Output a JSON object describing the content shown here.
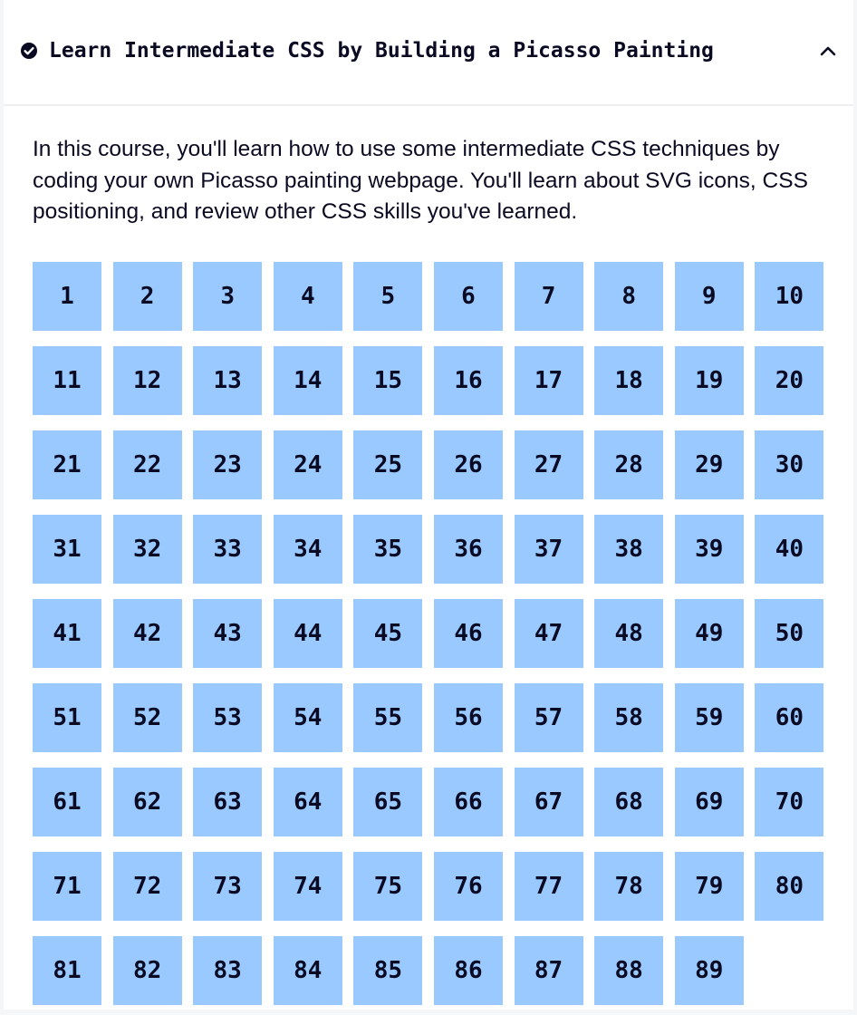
{
  "block": {
    "title": "Learn Intermediate CSS by Building a Picasso Painting",
    "status_icon": "check-circle-icon",
    "toggle_icon": "chevron-up-icon",
    "completed": true,
    "expanded": true
  },
  "intro_text": "In this course, you'll learn how to use some intermediate CSS techniques by coding your own Picasso painting webpage. You'll learn about SVG icons, CSS positioning, and review other CSS skills you've learned.",
  "steps": [
    "1",
    "2",
    "3",
    "4",
    "5",
    "6",
    "7",
    "8",
    "9",
    "10",
    "11",
    "12",
    "13",
    "14",
    "15",
    "16",
    "17",
    "18",
    "19",
    "20",
    "21",
    "22",
    "23",
    "24",
    "25",
    "26",
    "27",
    "28",
    "29",
    "30",
    "31",
    "32",
    "33",
    "34",
    "35",
    "36",
    "37",
    "38",
    "39",
    "40",
    "41",
    "42",
    "43",
    "44",
    "45",
    "46",
    "47",
    "48",
    "49",
    "50",
    "51",
    "52",
    "53",
    "54",
    "55",
    "56",
    "57",
    "58",
    "59",
    "60",
    "61",
    "62",
    "63",
    "64",
    "65",
    "66",
    "67",
    "68",
    "69",
    "70",
    "71",
    "72",
    "73",
    "74",
    "75",
    "76",
    "77",
    "78",
    "79",
    "80",
    "81",
    "82",
    "83",
    "84",
    "85",
    "86",
    "87",
    "88",
    "89"
  ],
  "colors": {
    "step_background": "#99c9ff",
    "text": "#0a0a23",
    "card_background": "#ffffff",
    "page_background": "#f5f6f7"
  }
}
